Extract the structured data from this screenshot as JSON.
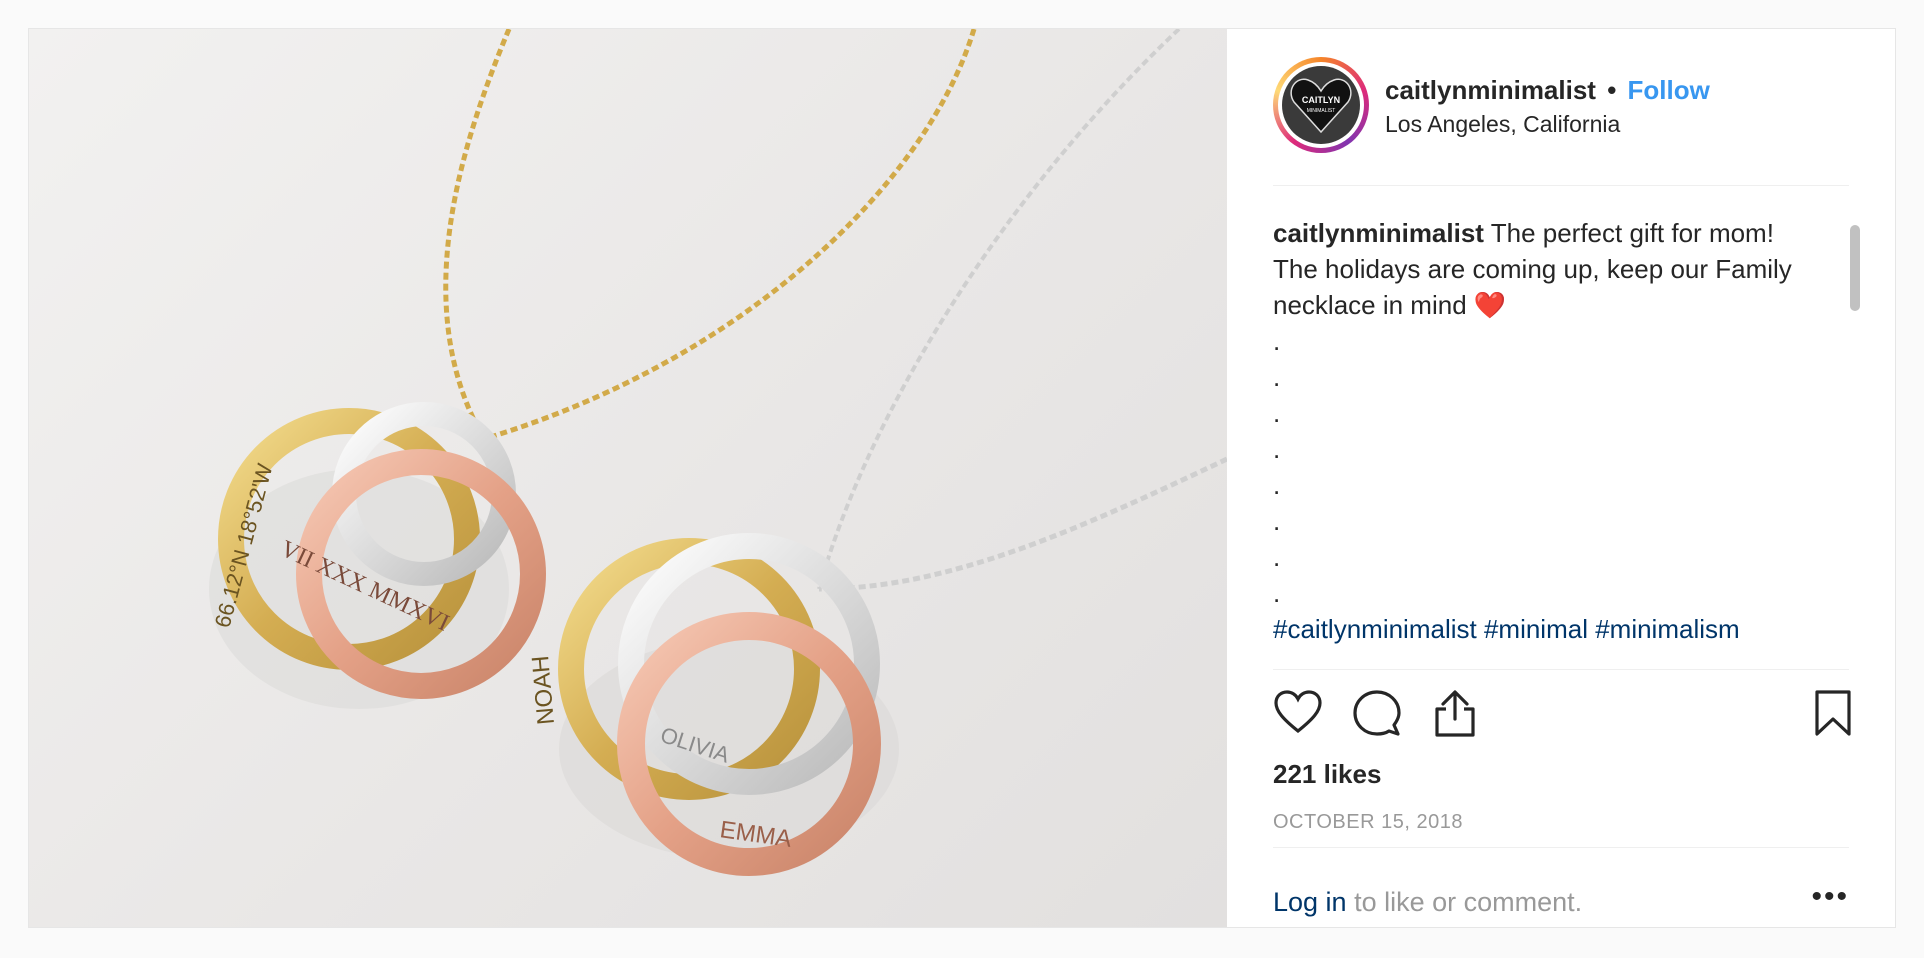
{
  "post": {
    "username": "caitlynminimalist",
    "separator": "•",
    "follow_label": "Follow",
    "location": "Los Angeles, California",
    "avatar_text_top": "CAITLYN",
    "avatar_text_bottom": "MINIMALIST",
    "caption_user": "caitlynminimalist",
    "caption_text": "The perfect gift for mom! The holidays are coming up, keep our Family necklace in mind",
    "caption_emoji": "❤️",
    "caption_dots": [
      ".",
      ".",
      ".",
      ".",
      ".",
      ".",
      ".",
      "."
    ],
    "hashtags": "#caitlynminimalist #minimal #minimalism",
    "likes": "221 likes",
    "date": "OCTOBER 15, 2018",
    "login_link": "Log in",
    "login_rest": " to like or comment.",
    "more_label": "•••"
  },
  "photo": {
    "ring_engravings": {
      "left_gold": "66.12°N 18°52'W",
      "left_rose": "VII XXX MMXVI",
      "right_gold": "NOAH",
      "right_silver": "OLIVIA",
      "right_rose": "EMMA"
    }
  },
  "icons": {
    "like": "heart-icon",
    "comment": "comment-icon",
    "share": "share-icon",
    "save": "bookmark-icon",
    "more": "more-options-icon"
  },
  "colors": {
    "follow": "#3897f0",
    "hashtag": "#003569",
    "secondary_text": "#999999",
    "gold": "#d9b45a",
    "rose_gold": "#e6a58c",
    "silver": "#dcdcdc"
  }
}
